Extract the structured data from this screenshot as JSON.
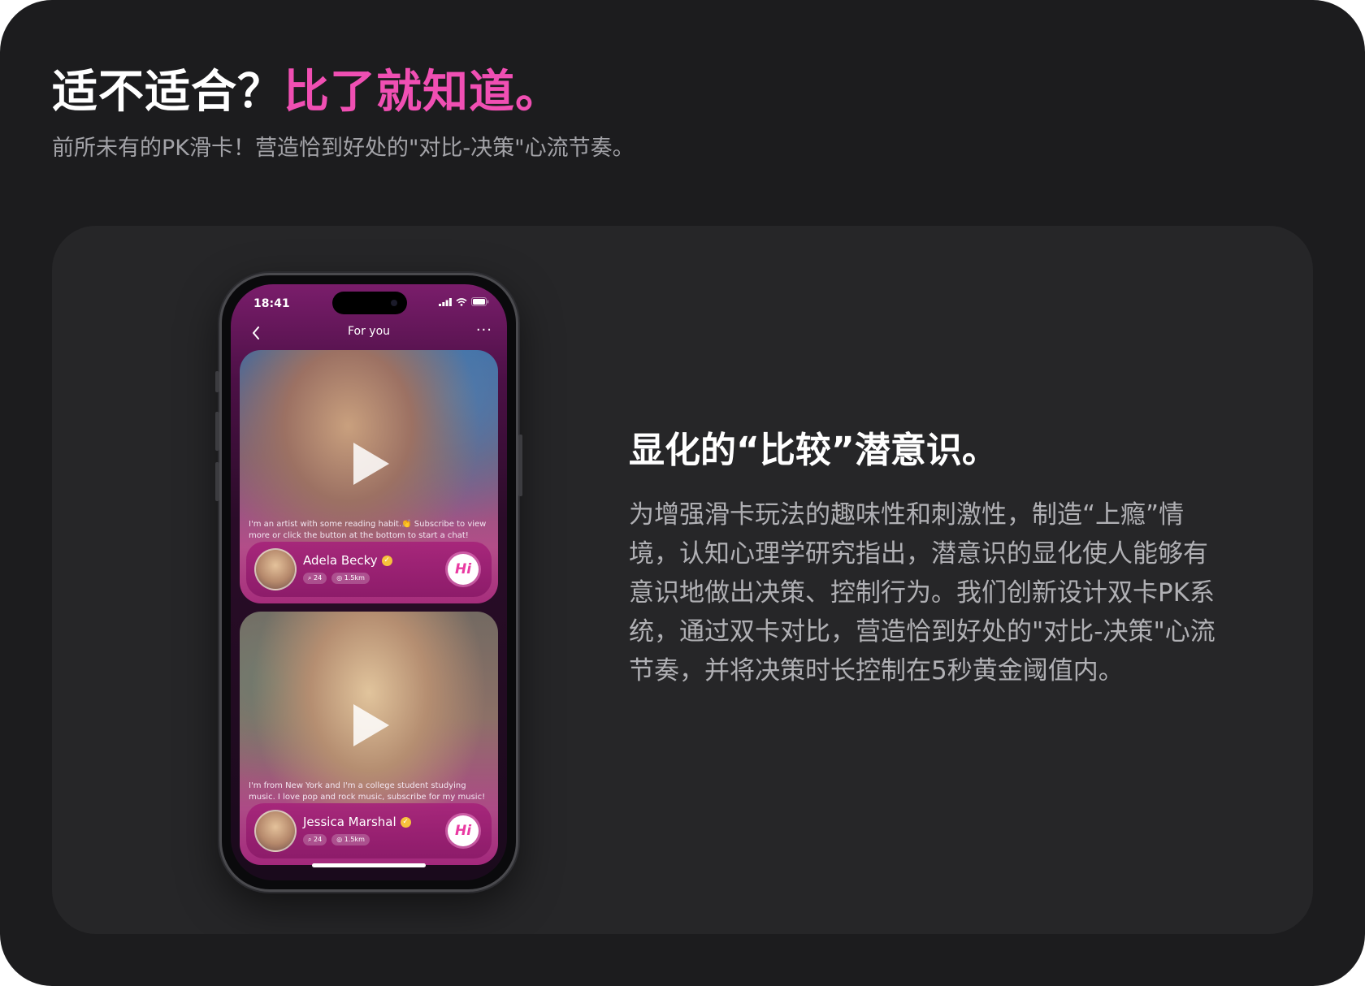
{
  "header": {
    "title_prefix": "适不适合？",
    "title_accent": "比了就知道。",
    "subtitle": "前所未有的PK滑卡！营造恰到好处的\"对比-决策\"心流节奏。"
  },
  "phone": {
    "status_time": "18:41",
    "nav_title": "For you",
    "more_label": "···",
    "cards": [
      {
        "bio": "I'm an artist with some reading habit.👏 Subscribe to view more or click the button at the bottom to start a chat!",
        "name": "Adela Becky",
        "count_tag": "24",
        "distance_tag": "1.5km",
        "hi_label": "Hi"
      },
      {
        "bio": "I'm from New York and I'm a college student studying music. I love pop and rock music, subscribe for my music!",
        "name": "Jessica Marshal",
        "count_tag": "24",
        "distance_tag": "1.5km",
        "hi_label": "Hi"
      }
    ]
  },
  "feature": {
    "title": "显化的“比较”潜意识。",
    "body": "为增强滑卡玩法的趣味性和刺激性，制造“上瘾”情境，认知心理学研究指出，潜意识的显化使人能够有意识地做出决策、控制行为。我们创新设计双卡PK系统，通过双卡对比，营造恰到好处的\"对比-决策\"心流节奏，并将决策时长控制在5秒黄金阈值内。"
  },
  "colors": {
    "background": "#1c1c1e",
    "card": "#262628",
    "accent": "#f04fb3",
    "muted_text": "#b0b0b4"
  },
  "icons": [
    "back-chevron-icon",
    "more-dots-icon",
    "play-icon",
    "verified-icon",
    "chat-count-icon",
    "location-icon",
    "signal-icon",
    "wifi-icon",
    "battery-icon"
  ]
}
